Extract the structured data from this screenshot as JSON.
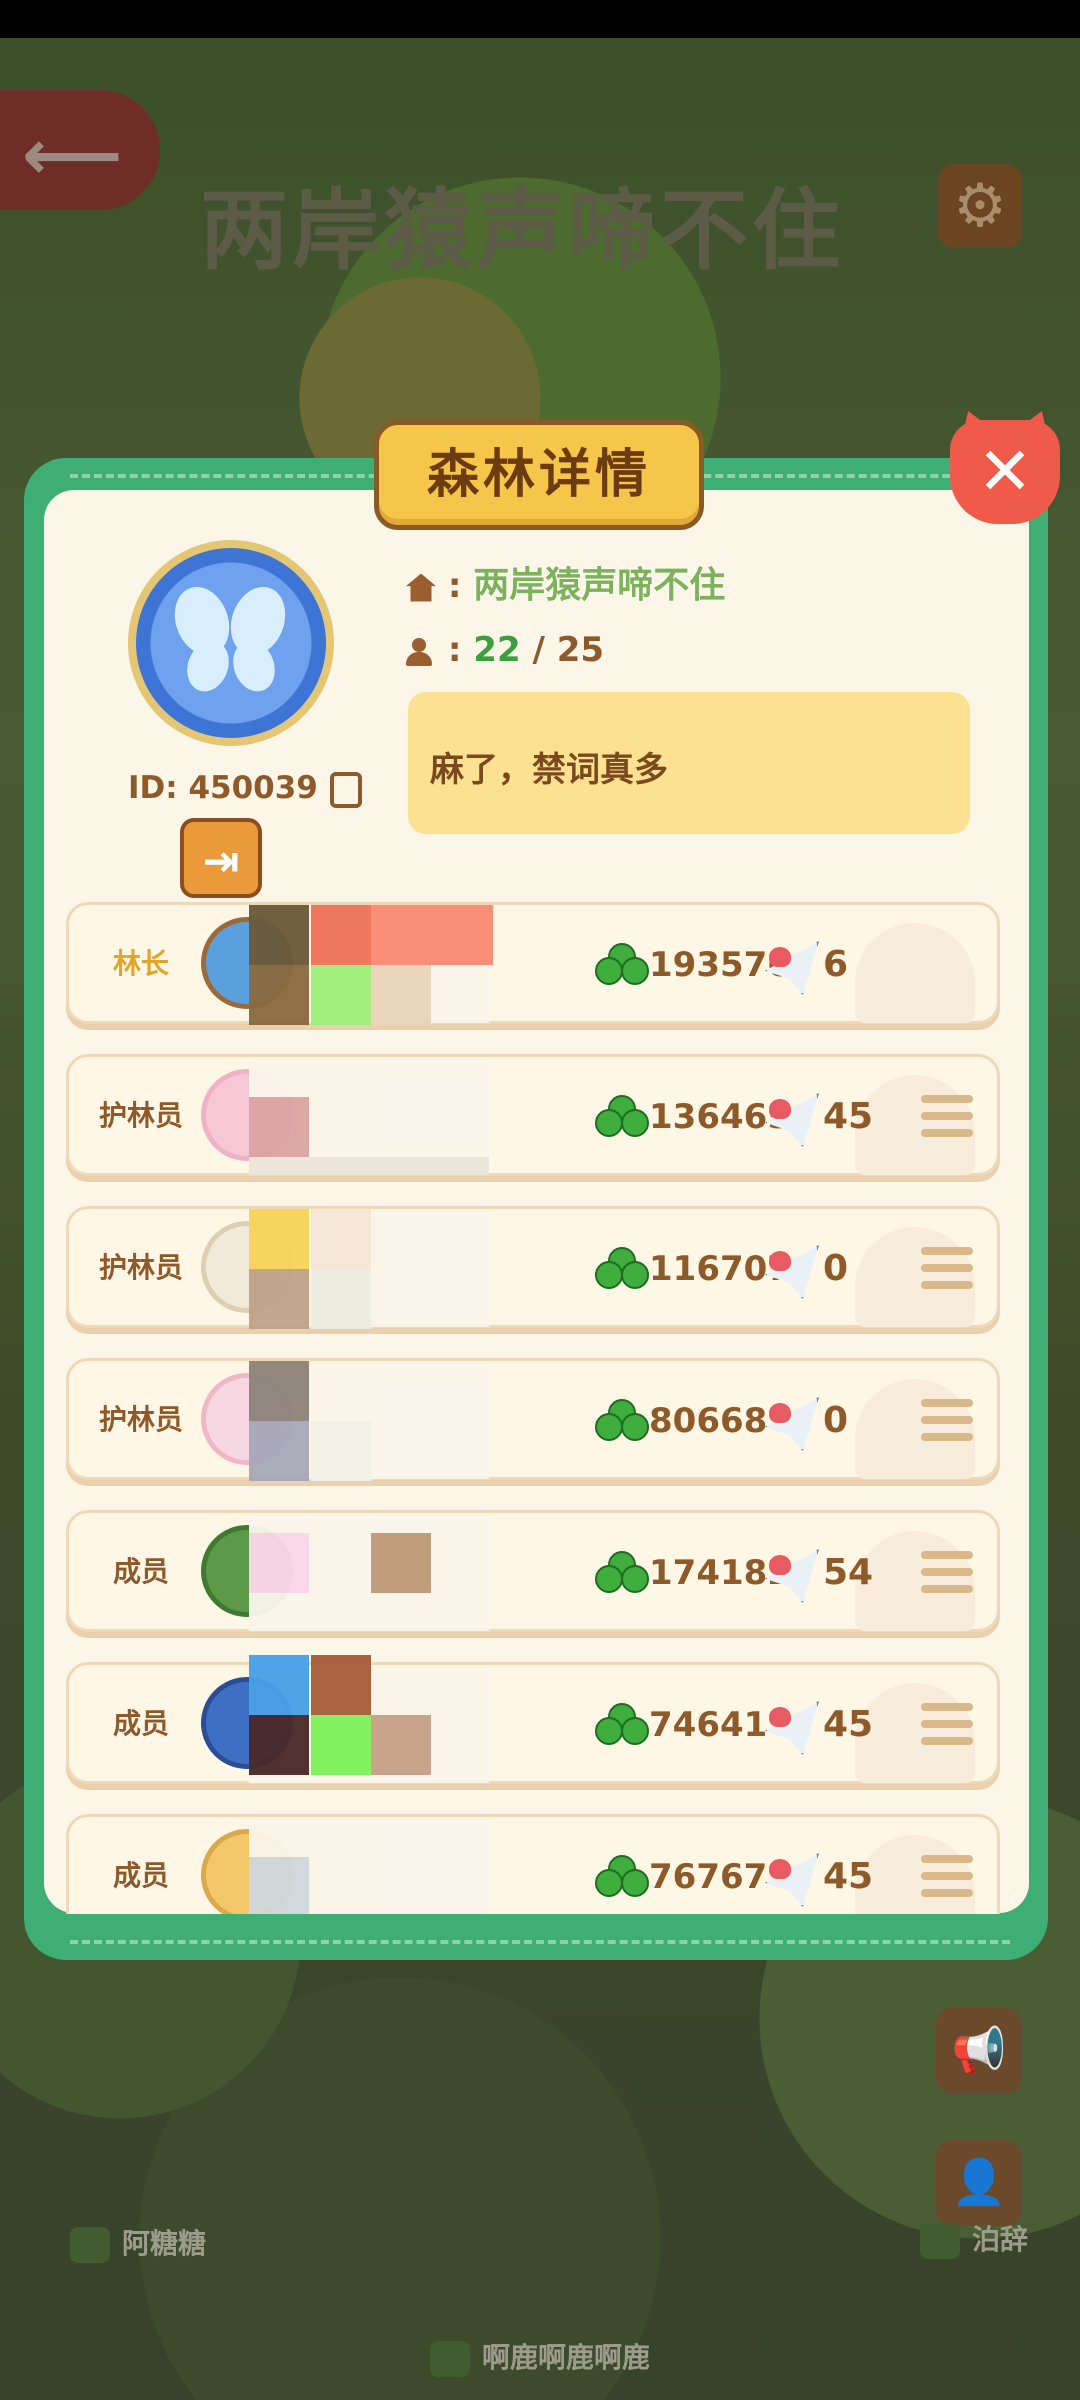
{
  "background": {
    "title": "两岸猿声啼不住",
    "map_labels": [
      "阿糖糖",
      "泊辞",
      "啊鹿啊鹿啊鹿"
    ]
  },
  "dialog": {
    "title": "森林详情",
    "close_label": "✕",
    "forest_id": "ID: 450039",
    "forest_name": "两岸猿声啼不住",
    "separator": ":",
    "members_current": "22",
    "members_max": "/ 25",
    "announcement": "麻了，禁词真多"
  },
  "members": [
    {
      "role": "林长",
      "score": "193576",
      "likes": "6",
      "leader": true
    },
    {
      "role": "护林员",
      "score": "136465",
      "likes": "45"
    },
    {
      "role": "护林员",
      "score": "116707",
      "likes": "0"
    },
    {
      "role": "护林员",
      "score": "80668",
      "likes": "0"
    },
    {
      "role": "成员",
      "score": "174182",
      "likes": "54"
    },
    {
      "role": "成员",
      "score": "74641",
      "likes": "45"
    },
    {
      "role": "成员",
      "score": "76767",
      "likes": "45"
    }
  ],
  "colors": {
    "panel_green": "#3fae74",
    "clover_green": "#3fae3f",
    "title_gold": "#f6c64a",
    "close_red": "#ef5a4a"
  }
}
